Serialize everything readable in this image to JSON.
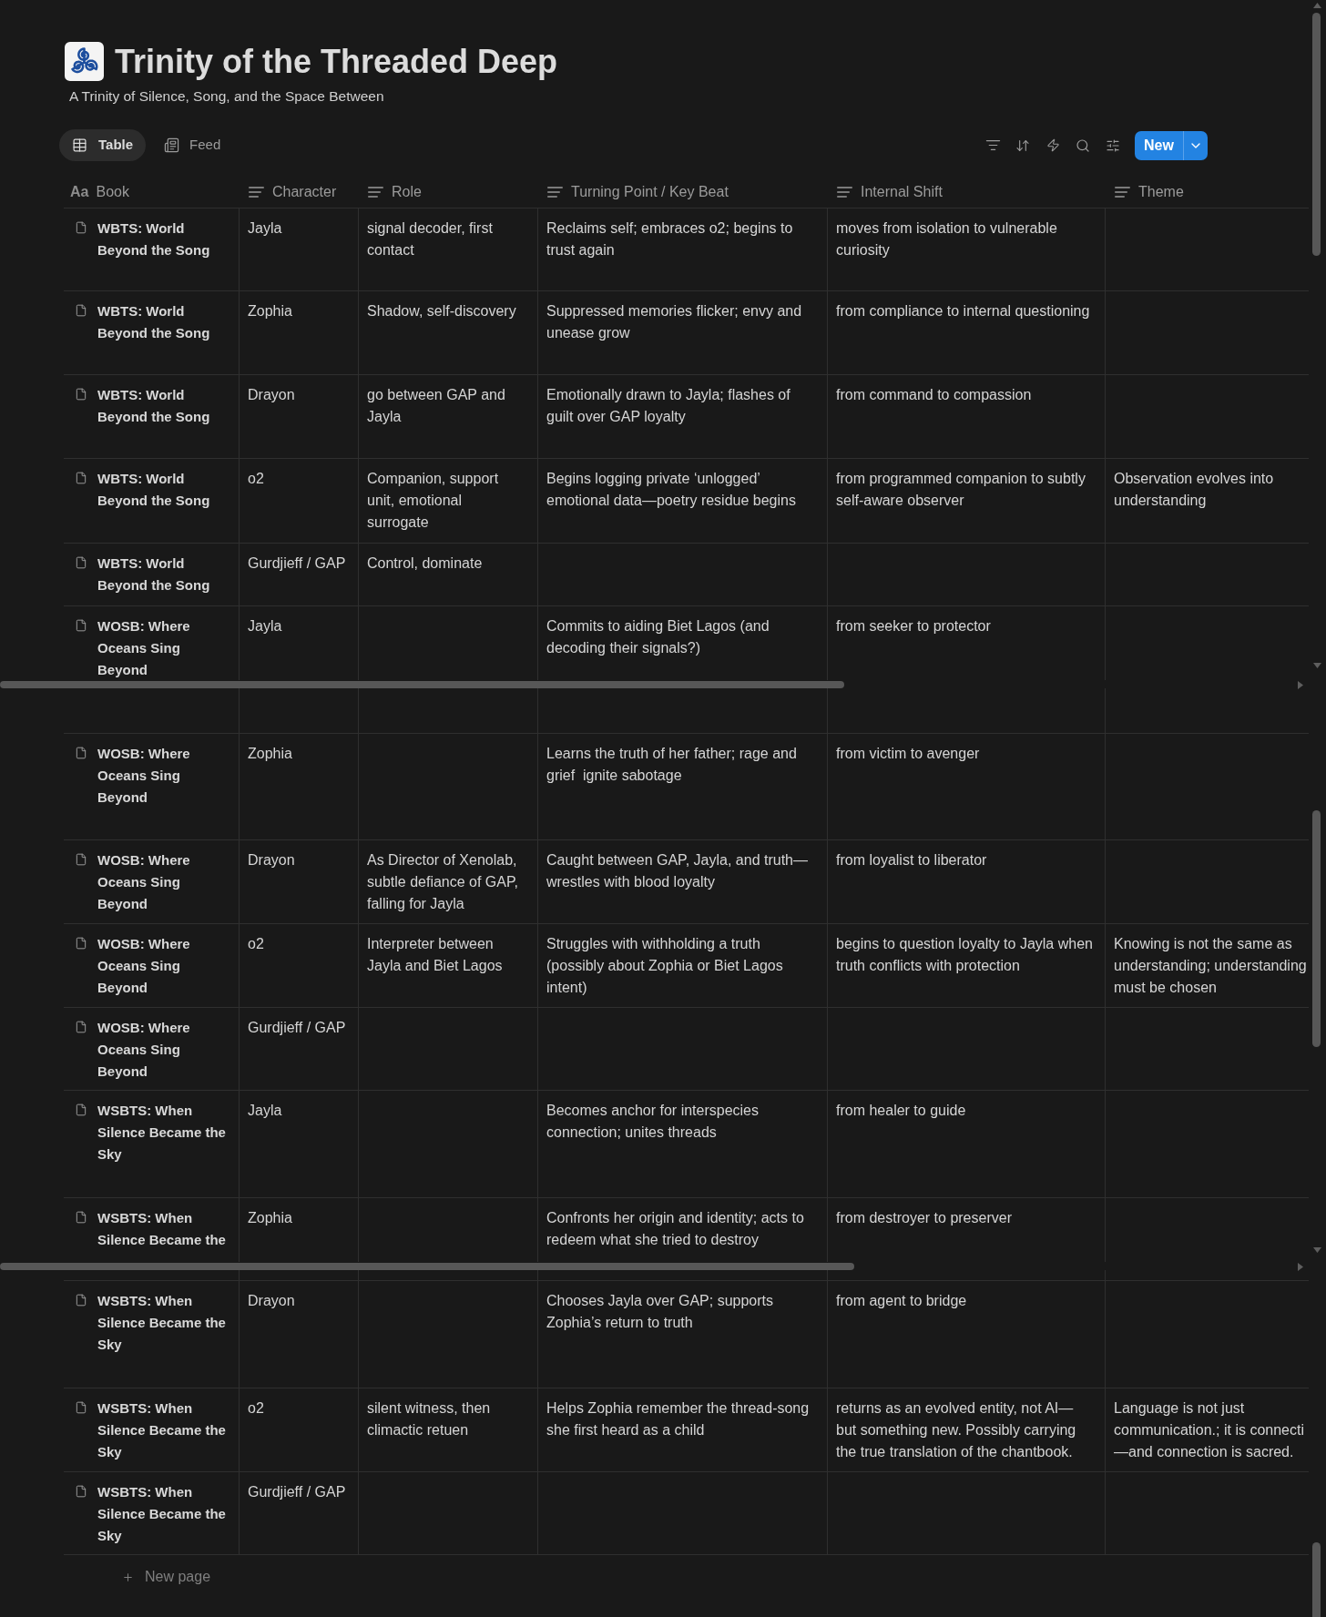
{
  "page": {
    "title": "Trinity of the Threaded Deep",
    "subtitle": "A Trinity of Silence, Song, and the Space Between"
  },
  "views": [
    {
      "label": "Table",
      "kind": "table",
      "selected": true
    },
    {
      "label": "Feed",
      "kind": "feed",
      "selected": false
    }
  ],
  "toolbar": {
    "new_button": "New"
  },
  "table": {
    "columns": [
      {
        "label": "Book",
        "kind": "title",
        "icon_text": "Aa"
      },
      {
        "label": "Character",
        "kind": "text"
      },
      {
        "label": "Role",
        "kind": "text"
      },
      {
        "label": "Turning Point / Key Beat",
        "kind": "text"
      },
      {
        "label": "Internal Shift",
        "kind": "text"
      },
      {
        "label": "Theme",
        "kind": "text"
      }
    ],
    "sections": [
      {
        "rows": [
          {
            "book": "WBTS: World Beyond the Song",
            "character": "Jayla",
            "role": "signal decoder, first contact",
            "turning_point": "Reclaims self; embraces o2; begins to trust again",
            "internal_shift": "moves from isolation to vulnerable curiosity"
          },
          {
            "book": "WBTS: World Beyond the Song",
            "character": "Zophia",
            "role": "Shadow, self-discovery",
            "turning_point": "Suppressed memories flicker; envy and unease grow",
            "internal_shift": "from compliance to internal questioning"
          },
          {
            "book": "WBTS: World Beyond the Song",
            "character": "Drayon",
            "role": "go between GAP and Jayla",
            "turning_point": "Emotionally drawn to Jayla; flashes of guilt over GAP loyalty",
            "internal_shift": "from command to compassion"
          },
          {
            "book": "WBTS: World Beyond the Song",
            "character": "o2",
            "role": "Companion, support unit, emotional surrogate",
            "turning_point": "Begins logging private ‘unlogged’ emotional data—poetry residue begins",
            "internal_shift": "from programmed companion to subtly self-aware observer",
            "theme": "Observation evolves into understanding"
          },
          {
            "book": "WBTS: World Beyond the Song",
            "character": "Gurdjieff / GAP",
            "role": "Control, dominate"
          },
          {
            "book": "WOSB: Where Oceans Sing Beyond",
            "character": "Jayla",
            "turning_point": "Commits to aiding Biet Lagos (and decoding their signals?)",
            "internal_shift": "from seeker to protector"
          }
        ]
      },
      {
        "rows": [
          {
            "book": "WOSB: Where Oceans Sing Beyond",
            "character": "Zophia",
            "turning_point": "Learns the truth of her father; rage and grief  ignite sabotage",
            "internal_shift": "from victim to avenger"
          },
          {
            "book": "WOSB: Where Oceans Sing Beyond",
            "character": "Drayon",
            "role": "As Director of Xenolab, subtle defiance of GAP, falling for Jayla",
            "turning_point": "Caught between GAP, Jayla, and truth—wrestles with blood loyalty",
            "internal_shift": "from loyalist to liberator"
          },
          {
            "book": "WOSB: Where Oceans Sing Beyond",
            "character": "o2",
            "role": "Interpreter between Jayla and Biet Lagos",
            "turning_point": "Struggles with withholding a truth (possibly about Zophia or Biet Lagos intent)",
            "internal_shift": "begins to question loyalty to Jayla when truth conflicts with protection",
            "theme": "Knowing is not the same as understanding; understanding must be chosen"
          },
          {
            "book": "WOSB: Where Oceans Sing Beyond",
            "character": "Gurdjieff / GAP"
          },
          {
            "book": "WSBTS: When Silence Became the Sky",
            "character": "Jayla",
            "turning_point": "Becomes anchor for interspecies connection; unites threads",
            "internal_shift": "from healer to guide"
          },
          {
            "book": "WSBTS: When Silence Became the",
            "character": "Zophia",
            "turning_point": "Confronts her origin and identity; acts to redeem what she tried to destroy",
            "internal_shift": "from destroyer to preserver"
          }
        ]
      },
      {
        "rows": [
          {
            "book": "WSBTS: When Silence Became the Sky",
            "character": "Drayon",
            "turning_point": "Chooses Jayla over GAP; supports Zophia’s return to truth",
            "internal_shift": "from agent to bridge"
          },
          {
            "book": "WSBTS: When Silence Became the Sky",
            "character": "o2",
            "role": "silent witness, then climactic retuen",
            "turning_point": "Helps Zophia remember the thread-song she first heard as a child",
            "internal_shift": "returns as an evolved entity, not AI—but something new. Possibly carrying the true translation of the chantbook.",
            "theme": "Language is not just communication.; it is connecti —and connection is sacred."
          },
          {
            "book": "WSBTS: When Silence Became the Sky",
            "character": "Gurdjieff / GAP"
          }
        ]
      }
    ],
    "add_row": "New page"
  }
}
